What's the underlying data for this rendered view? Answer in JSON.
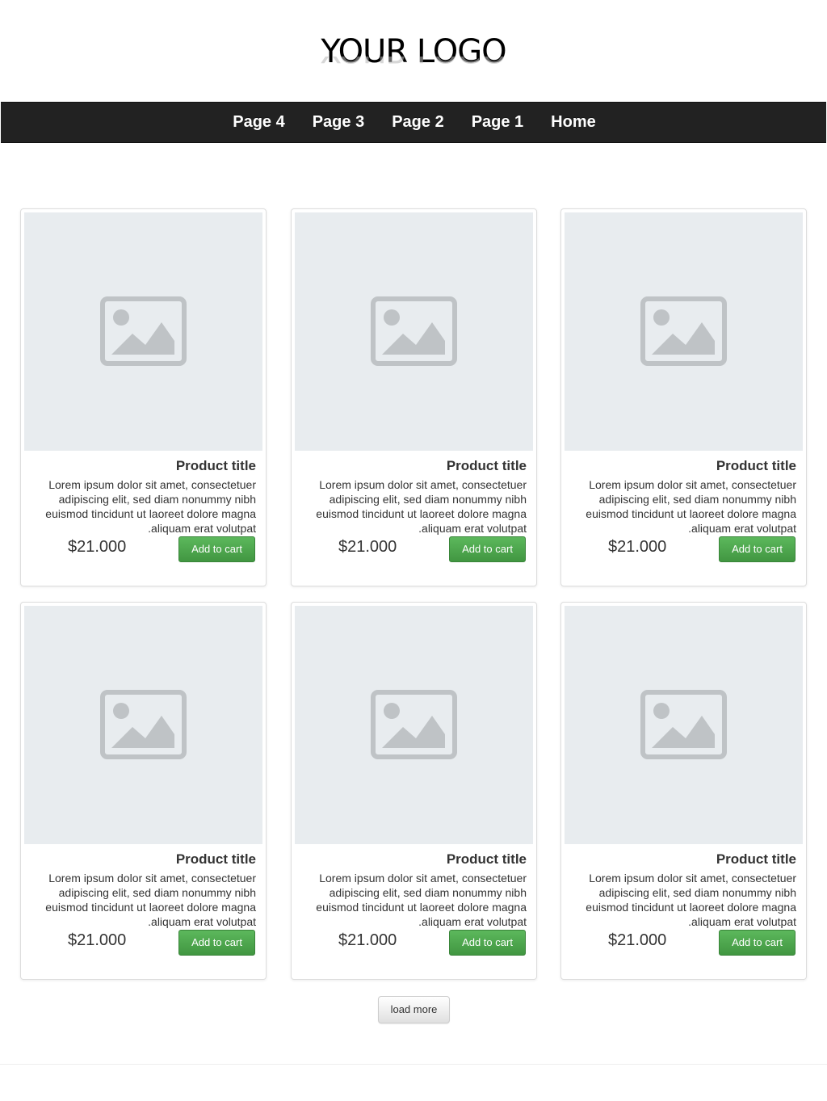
{
  "header": {
    "logo_text": "YOUR LOGO"
  },
  "nav": {
    "items": [
      {
        "label": "Page 4"
      },
      {
        "label": "Page 3"
      },
      {
        "label": "Page 2"
      },
      {
        "label": "Page 1"
      },
      {
        "label": "Home"
      }
    ]
  },
  "products": [
    {
      "title": "Product title",
      "description": "Lorem ipsum dolor sit amet, consectetuer adipiscing elit, sed diam nonummy nibh euismod tincidunt ut laoreet dolore magna aliquam erat volutpat.",
      "price": "$21.000",
      "button_label": "Add to cart",
      "image_icon": "image-placeholder-icon"
    },
    {
      "title": "Product title",
      "description": "Lorem ipsum dolor sit amet, consectetuer adipiscing elit, sed diam nonummy nibh euismod tincidunt ut laoreet dolore magna aliquam erat volutpat.",
      "price": "$21.000",
      "button_label": "Add to cart",
      "image_icon": "image-placeholder-icon"
    },
    {
      "title": "Product title",
      "description": "Lorem ipsum dolor sit amet, consectetuer adipiscing elit, sed diam nonummy nibh euismod tincidunt ut laoreet dolore magna aliquam erat volutpat.",
      "price": "$21.000",
      "button_label": "Add to cart",
      "image_icon": "image-placeholder-icon"
    },
    {
      "title": "Product title",
      "description": "Lorem ipsum dolor sit amet, consectetuer adipiscing elit, sed diam nonummy nibh euismod tincidunt ut laoreet dolore magna aliquam erat volutpat.",
      "price": "$21.000",
      "button_label": "Add to cart",
      "image_icon": "image-placeholder-icon"
    },
    {
      "title": "Product title",
      "description": "Lorem ipsum dolor sit amet, consectetuer adipiscing elit, sed diam nonummy nibh euismod tincidunt ut laoreet dolore magna aliquam erat volutpat.",
      "price": "$21.000",
      "button_label": "Add to cart",
      "image_icon": "image-placeholder-icon"
    },
    {
      "title": "Product title",
      "description": "Lorem ipsum dolor sit amet, consectetuer adipiscing elit, sed diam nonummy nibh euismod tincidunt ut laoreet dolore magna aliquam erat volutpat.",
      "price": "$21.000",
      "button_label": "Add to cart",
      "image_icon": "image-placeholder-icon"
    }
  ],
  "load_more": {
    "label": "load more"
  },
  "colors": {
    "nav_background": "#222222",
    "button_green": "#5cb85c",
    "image_placeholder_bg": "#e8ecef",
    "image_placeholder_icon": "#bfc3c6"
  }
}
